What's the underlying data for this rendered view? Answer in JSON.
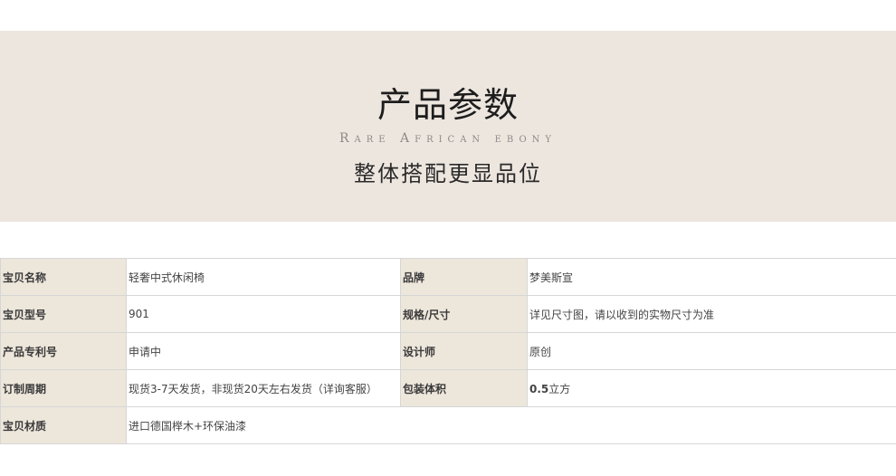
{
  "header": {
    "title": "产品参数",
    "subtitle_en": "Rare African ebony",
    "tagline": "整体搭配更显品位"
  },
  "params": {
    "rows": [
      {
        "label1": "宝贝名称",
        "value1": "轻奢中式休闲椅",
        "label2": "品牌",
        "value2": "梦美斯宣"
      },
      {
        "label1": "宝贝型号",
        "value1": "901",
        "label2": "规格/尺寸",
        "value2": "详见尺寸图，请以收到的实物尺寸为准"
      },
      {
        "label1": "产品专利号",
        "value1": "申请中",
        "label2": "设计师",
        "value2": "原创"
      },
      {
        "label1": "订制周期",
        "value1": "现货3-7天发货，非现货20天左右发货（详询客服）",
        "label2": "包装体积",
        "value2_num": "0.5",
        "value2_unit": "立方"
      },
      {
        "label1": "宝贝材质",
        "value1": "进口德国榉木+环保油漆"
      }
    ]
  },
  "colors": {
    "banner_bg": "#ede6df",
    "label_bg": "#ede6db",
    "border": "#d6d6d6"
  }
}
